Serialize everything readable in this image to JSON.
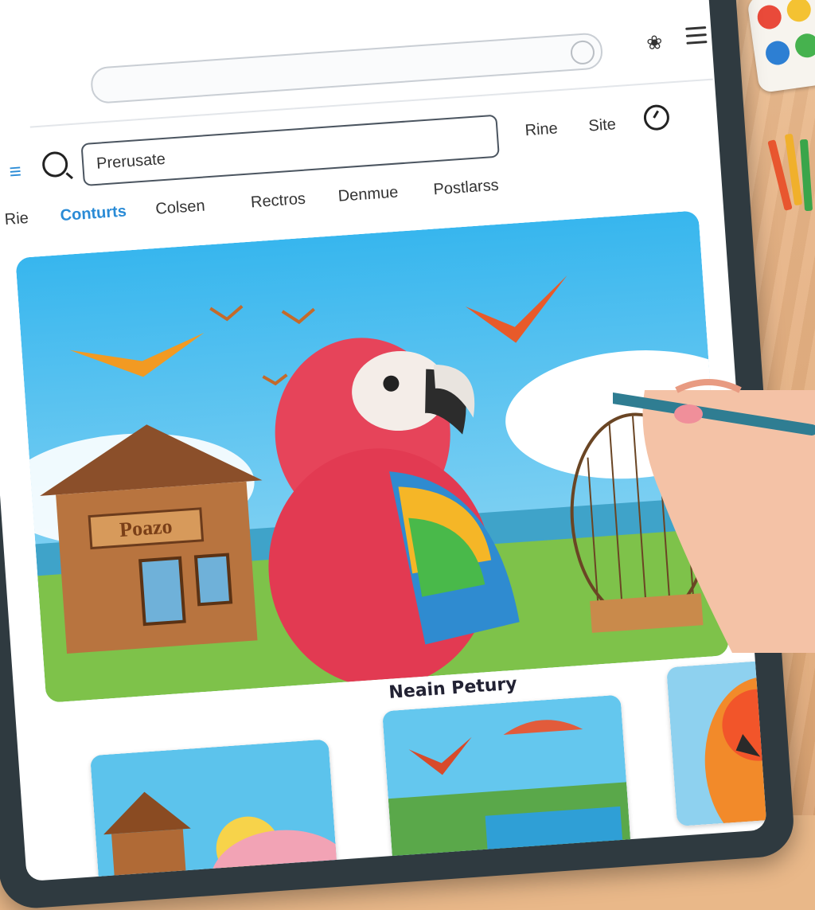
{
  "browser": {
    "search_placeholder": "Prerusate",
    "menu_icon": "hamburger-icon",
    "fish_icon": "fish-icon"
  },
  "nav_top": {
    "items": [
      "Postlarss",
      "Rine",
      "Site"
    ]
  },
  "tabs": {
    "items": [
      "Rie",
      "Conturts",
      "Colsen",
      "Rectros",
      "Denmue"
    ],
    "active": "Conturts"
  },
  "hero": {
    "sign_text": "Poazo",
    "caption": "Neain Petury"
  },
  "colors": {
    "accent": "#2a8bd6",
    "frame": "#2f3a40",
    "sky": "#4cc3f0"
  }
}
